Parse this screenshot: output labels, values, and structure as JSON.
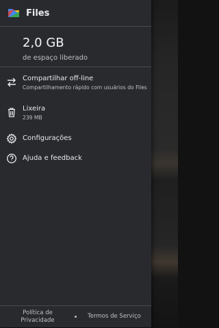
{
  "app": {
    "title": "Files"
  },
  "storage": {
    "amount": "2,0 GB",
    "label": "de espaço liberado"
  },
  "menu": {
    "share": {
      "title": "Compartilhar off-line",
      "subtitle": "Compartilhamento rápido com usuários do Files",
      "icon": "swap-arrows-icon"
    },
    "trash": {
      "title": "Lixeira",
      "subtitle": "239 MB",
      "icon": "trash-icon"
    },
    "settings": {
      "title": "Configurações",
      "icon": "gear-icon"
    },
    "help": {
      "title": "Ajuda e feedback",
      "icon": "help-icon"
    }
  },
  "footer": {
    "privacy": "Política de Privacidade",
    "terms": "Termos de Serviço"
  },
  "colors": {
    "drawer_bg": "#292a2d",
    "text": "#e8eaed",
    "secondary": "#bdc1c6"
  }
}
